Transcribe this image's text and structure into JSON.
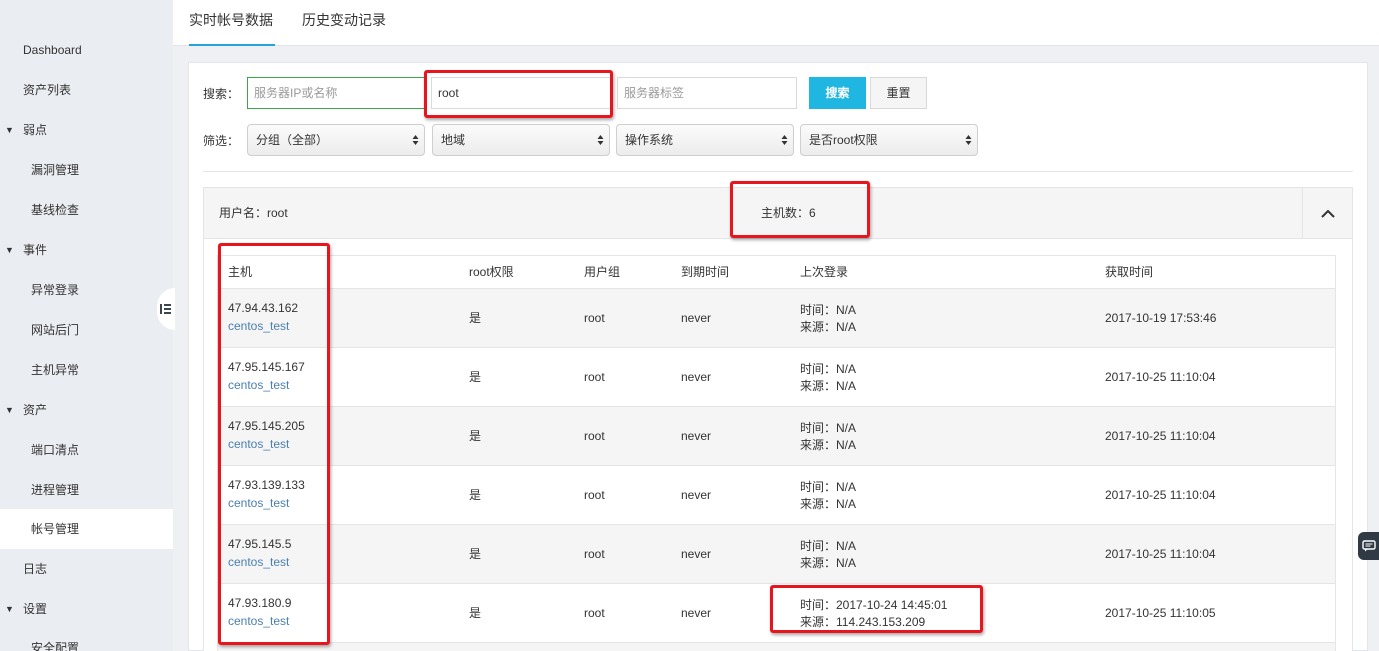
{
  "sidebar": {
    "items": [
      {
        "label": "Dashboard"
      },
      {
        "label": "资产列表"
      },
      {
        "label": "弱点"
      },
      {
        "label": "漏洞管理"
      },
      {
        "label": "基线检查"
      },
      {
        "label": "事件"
      },
      {
        "label": "异常登录"
      },
      {
        "label": "网站后门"
      },
      {
        "label": "主机异常"
      },
      {
        "label": "资产"
      },
      {
        "label": "端口清点"
      },
      {
        "label": "进程管理"
      },
      {
        "label": "帐号管理"
      },
      {
        "label": "日志"
      },
      {
        "label": "设置"
      },
      {
        "label": "安全配置"
      }
    ],
    "active": "帐号管理"
  },
  "tabs": [
    {
      "label": "实时帐号数据"
    },
    {
      "label": "历史变动记录"
    }
  ],
  "search": {
    "label": "搜索：",
    "ip_placeholder": "服务器IP或名称",
    "username_value": "root",
    "tag_placeholder": "服务器标签",
    "search_button": "搜索",
    "reset_button": "重置"
  },
  "filter": {
    "label": "筛选：",
    "group": "分组（全部）",
    "region": "地域",
    "os": "操作系统",
    "root": "是否root权限"
  },
  "card": {
    "username_label": "用户名：root",
    "host_count_label": "主机数：6"
  },
  "table": {
    "headers": [
      "主机",
      "root权限",
      "用户组",
      "到期时间",
      "上次登录",
      "获取时间"
    ],
    "rows": [
      {
        "ip": "47.94.43.162",
        "name": "centos_test",
        "root": "是",
        "group": "root",
        "expire": "never",
        "login_time": "时间：N/A",
        "login_src": "来源：N/A",
        "fetched": "2017-10-19 17:53:46"
      },
      {
        "ip": "47.95.145.167",
        "name": "centos_test",
        "root": "是",
        "group": "root",
        "expire": "never",
        "login_time": "时间：N/A",
        "login_src": "来源：N/A",
        "fetched": "2017-10-25 11:10:04"
      },
      {
        "ip": "47.95.145.205",
        "name": "centos_test",
        "root": "是",
        "group": "root",
        "expire": "never",
        "login_time": "时间：N/A",
        "login_src": "来源：N/A",
        "fetched": "2017-10-25 11:10:04"
      },
      {
        "ip": "47.93.139.133",
        "name": "centos_test",
        "root": "是",
        "group": "root",
        "expire": "never",
        "login_time": "时间：N/A",
        "login_src": "来源：N/A",
        "fetched": "2017-10-25 11:10:04"
      },
      {
        "ip": "47.95.145.5",
        "name": "centos_test",
        "root": "是",
        "group": "root",
        "expire": "never",
        "login_time": "时间：N/A",
        "login_src": "来源：N/A",
        "fetched": "2017-10-25 11:10:04"
      },
      {
        "ip": "47.93.180.9",
        "name": "centos_test",
        "root": "是",
        "group": "root",
        "expire": "never",
        "login_time": "时间：2017-10-24 14:45:01",
        "login_src": "来源：114.243.153.209",
        "fetched": "2017-10-25 11:10:05"
      }
    ]
  },
  "colors": {
    "accent": "#1fb6e1",
    "tab_underline": "#29a3d4",
    "link": "#4a7fb1",
    "highlight": "#e8141e",
    "sidebar_bg": "#eaedf1"
  }
}
